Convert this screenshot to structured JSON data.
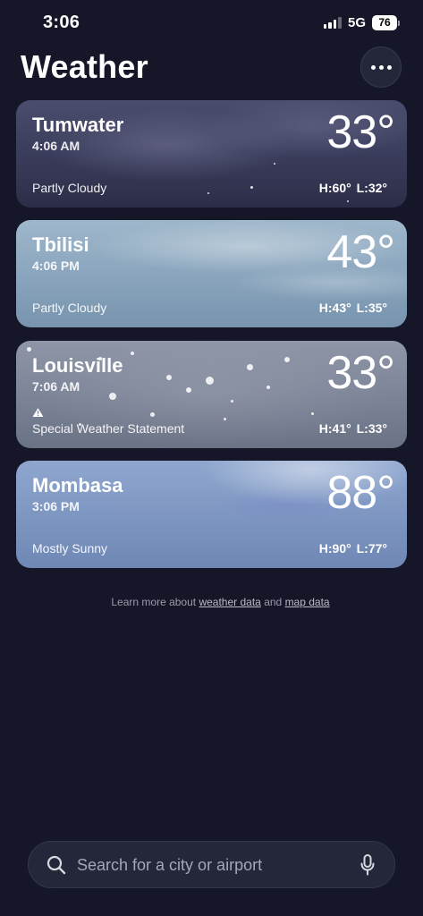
{
  "status_bar": {
    "time": "3:06",
    "network": "5G",
    "battery": "76"
  },
  "header": {
    "title": "Weather"
  },
  "cities": [
    {
      "name": "Tumwater",
      "time": "4:06 AM",
      "temp": "33°",
      "condition": "Partly Cloudy",
      "hilo": "H:60° L:32°"
    },
    {
      "name": "Tbilisi",
      "time": "4:06 PM",
      "temp": "43°",
      "condition": "Partly Cloudy",
      "hilo": "H:43° L:35°"
    },
    {
      "name": "Louisville",
      "time": "7:06 AM",
      "temp": "33°",
      "condition": "Special Weather Statement",
      "hilo": "H:41° L:33°",
      "alert_icon": "warning-triangle-icon"
    },
    {
      "name": "Mombasa",
      "time": "3:06 PM",
      "temp": "88°",
      "condition": "Mostly Sunny",
      "hilo": "H:90° L:77°"
    }
  ],
  "footer": {
    "prefix": "Learn more about",
    "weather_link": "weather data",
    "conjunction": "and",
    "map_link": "map data"
  },
  "search": {
    "placeholder": "Search for a city or airport"
  },
  "icons": {
    "more": "ellipsis-icon",
    "search": "magnifier-icon",
    "mic": "microphone-icon"
  }
}
